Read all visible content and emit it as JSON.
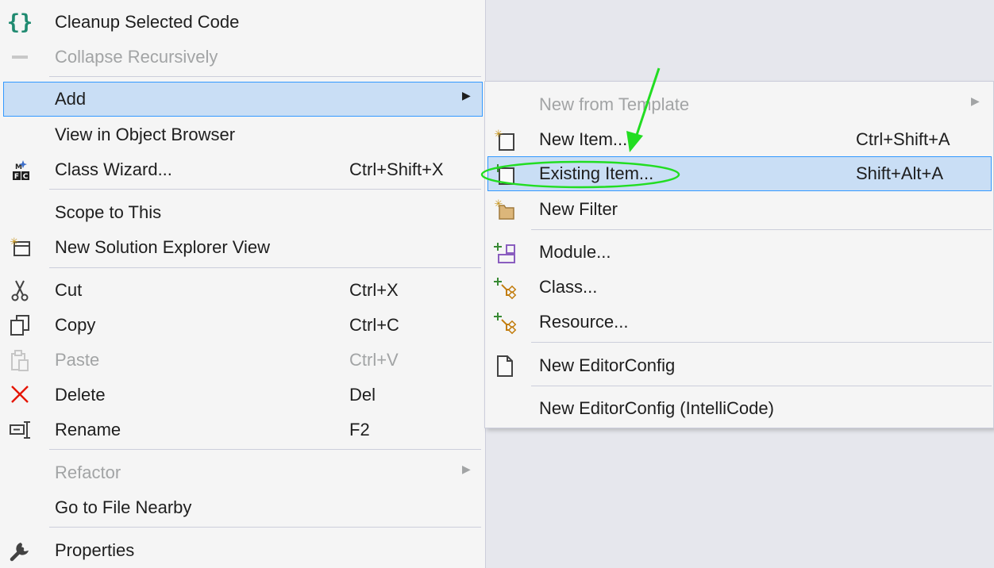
{
  "main_menu": {
    "items": {
      "cleanup": {
        "label": "Cleanup Selected Code",
        "icon": "braces-icon"
      },
      "collapse": {
        "label": "Collapse Recursively",
        "icon": "collapse-icon",
        "disabled": true
      },
      "add": {
        "label": "Add",
        "submenu": true,
        "highlighted": true
      },
      "object_browser": {
        "label": "View in Object Browser"
      },
      "class_wizard": {
        "label": "Class Wizard...",
        "shortcut": "Ctrl+Shift+X",
        "icon": "mfc-class-wizard-icon"
      },
      "scope": {
        "label": "Scope to This"
      },
      "new_view": {
        "label": "New Solution Explorer View",
        "icon": "new-window-icon"
      },
      "cut": {
        "label": "Cut",
        "shortcut": "Ctrl+X",
        "icon": "scissors-icon"
      },
      "copy": {
        "label": "Copy",
        "shortcut": "Ctrl+C",
        "icon": "copy-icon"
      },
      "paste": {
        "label": "Paste",
        "shortcut": "Ctrl+V",
        "icon": "paste-icon",
        "disabled": true
      },
      "delete": {
        "label": "Delete",
        "shortcut": "Del",
        "icon": "delete-x-icon"
      },
      "rename": {
        "label": "Rename",
        "shortcut": "F2",
        "icon": "rename-icon"
      },
      "refactor": {
        "label": "Refactor",
        "submenu": true,
        "disabled": true
      },
      "go_to_file": {
        "label": "Go to File Nearby"
      },
      "properties": {
        "label": "Properties",
        "icon": "wrench-icon"
      }
    }
  },
  "sub_menu": {
    "items": {
      "new_from_template": {
        "label": "New from Template",
        "submenu": true,
        "disabled": true
      },
      "new_item": {
        "label": "New Item...",
        "shortcut": "Ctrl+Shift+A",
        "icon": "new-item-icon"
      },
      "existing_item": {
        "label": "Existing Item...",
        "shortcut": "Shift+Alt+A",
        "icon": "existing-item-icon",
        "highlighted": true
      },
      "new_filter": {
        "label": "New Filter",
        "icon": "new-folder-icon"
      },
      "module": {
        "label": "Module...",
        "icon": "add-module-icon"
      },
      "class": {
        "label": "Class...",
        "icon": "add-class-icon"
      },
      "resource": {
        "label": "Resource...",
        "icon": "add-resource-icon"
      },
      "editorconfig": {
        "label": "New EditorConfig",
        "icon": "document-icon"
      },
      "editorconfig_intellicode": {
        "label": "New EditorConfig (IntelliCode)"
      }
    }
  },
  "colors": {
    "menu_background": "#f5f5f5",
    "highlight_background": "#c9def5",
    "highlight_border": "#3399ff",
    "disabled_text": "#a2a4a5",
    "annotation_green": "#22dd22"
  }
}
